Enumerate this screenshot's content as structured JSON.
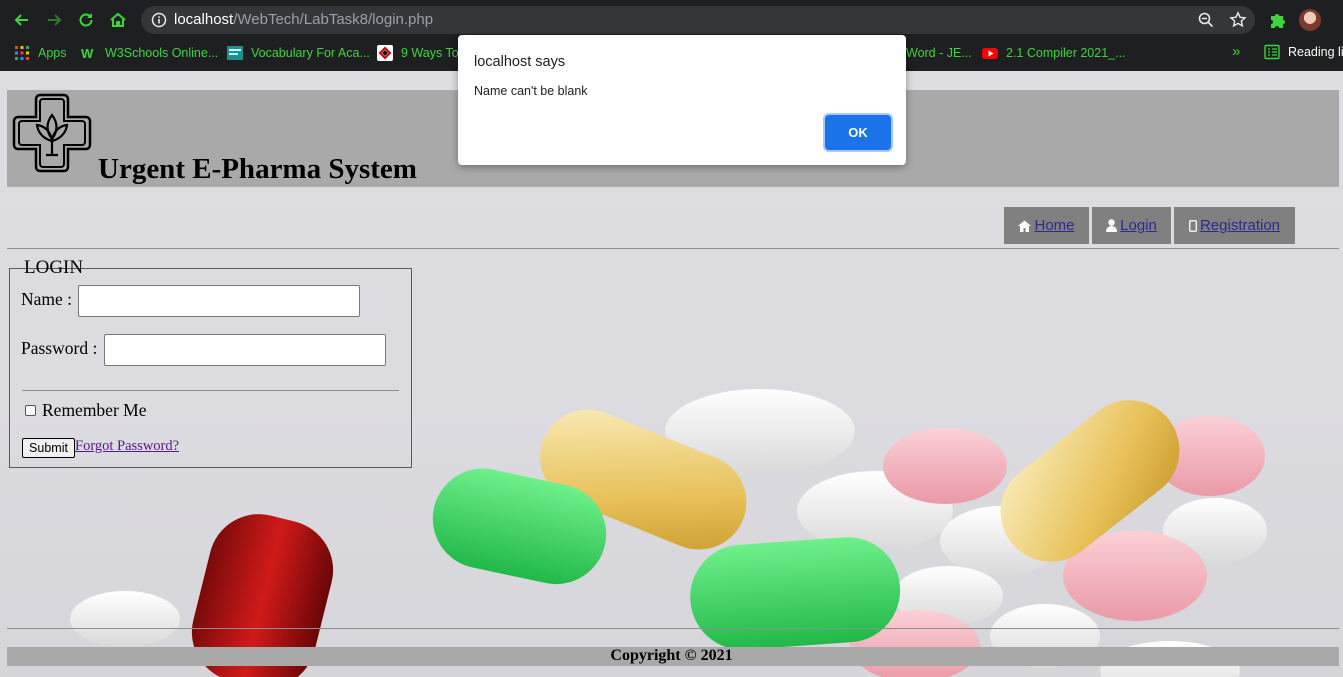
{
  "browser": {
    "url_host": "localhost",
    "url_path": "/WebTech/LabTask8/login.php",
    "bookmarks": [
      {
        "label": "Apps",
        "icon": "apps-grid-icon"
      },
      {
        "label": "W3Schools Online...",
        "icon": "w3schools-icon"
      },
      {
        "label": "Vocabulary For Aca...",
        "icon": "vocabulary-icon"
      },
      {
        "label": "9 Ways To",
        "icon": "ways-icon"
      },
      {
        "label": "Word - JE...",
        "icon": "word-icon"
      },
      {
        "label": "2.1 Compiler 2021_...",
        "icon": "youtube-icon"
      }
    ],
    "more": "»",
    "reading_list": "Reading lis"
  },
  "dialog": {
    "title": "localhost says",
    "message": "Name can't be blank",
    "ok_label": "OK"
  },
  "site": {
    "title": "Urgent E-Pharma System",
    "menu": [
      {
        "label": " Home",
        "icon": "home-icon"
      },
      {
        "label": " Login",
        "icon": "user-icon"
      },
      {
        "label": " Registration",
        "icon": "mobile-icon"
      }
    ]
  },
  "login": {
    "legend": "LOGIN",
    "name_label": "Name :",
    "name_value": "",
    "password_label": "Password :",
    "password_value": "",
    "remember_label": "Remember Me",
    "submit_label": "Submit",
    "forgot_label": "Forgot Password?"
  },
  "footer": {
    "copyright": "Copyright © 2021"
  },
  "colors": {
    "header_band": "#a9a9a9",
    "menu_button": "#808080",
    "dialog_ok": "#1a73e8",
    "bookmark_text": "#3cd63c"
  }
}
